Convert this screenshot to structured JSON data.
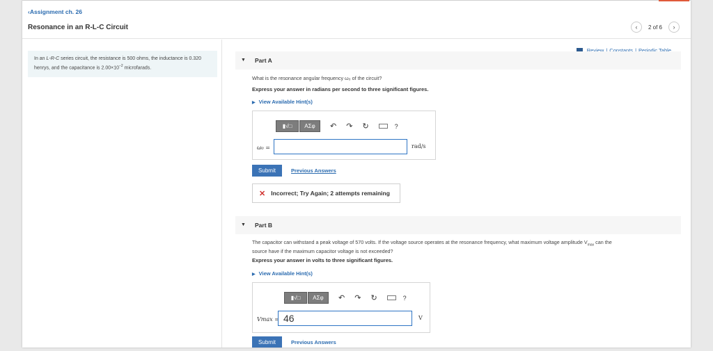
{
  "header": {
    "back_label": "Assignment ch. 26",
    "title": "Resonance in an R-L-C Circuit",
    "pager_text": "2 of 6",
    "prev_icon": "‹",
    "next_icon": "›"
  },
  "problem": {
    "text_before": "In an ",
    "circuit_type": "L-R-C",
    "text_after": " series circuit, the resistance is 500 ohms, the inductance is 0.320 henrys, and the capacitance is 2.00×10",
    "exponent": "−2",
    "text_end": " microfarads."
  },
  "review": {
    "review_label": "Review",
    "constants_label": "Constants",
    "periodic_label": "Periodic Table",
    "separator": "|"
  },
  "part_a": {
    "label": "Part A",
    "question": "What is the resonance angular frequency ω₀ of the circuit?",
    "instruction": "Express your answer in radians per second to three significant figures.",
    "hint_label": "View Available Hint(s)",
    "toolbar": {
      "template_label": "▮√□",
      "symbols_label": "ΑΣφ",
      "help_label": "?"
    },
    "var_label": "ω₀ =",
    "input_value": "",
    "unit": "rad/s",
    "submit_label": "Submit",
    "previous_answers_label": "Previous Answers",
    "feedback": "Incorrect; Try Again; 2 attempts remaining"
  },
  "part_b": {
    "label": "Part B",
    "question_line1": "The capacitor can withstand a peak voltage of 570 volts. If the voltage source operates at the resonance frequency, what maximum voltage amplitude V",
    "question_sub": "max",
    "question_line1_end": " can the",
    "question_line2": "source have if the maximum capacitor voltage is not exceeded?",
    "instruction": "Express your answer in volts to three significant figures.",
    "hint_label": "View Available Hint(s)",
    "toolbar": {
      "template_label": "▮√□",
      "symbols_label": "ΑΣφ",
      "help_label": "?"
    },
    "var_label": "Vmax =",
    "input_value": "46",
    "unit": "V",
    "submit_label": "Submit",
    "previous_answers_label": "Previous Answers"
  },
  "colors": {
    "link": "#2c6cb0",
    "submit": "#3b73b6",
    "error": "#d0322f",
    "problem_bg": "#eef5f7"
  }
}
